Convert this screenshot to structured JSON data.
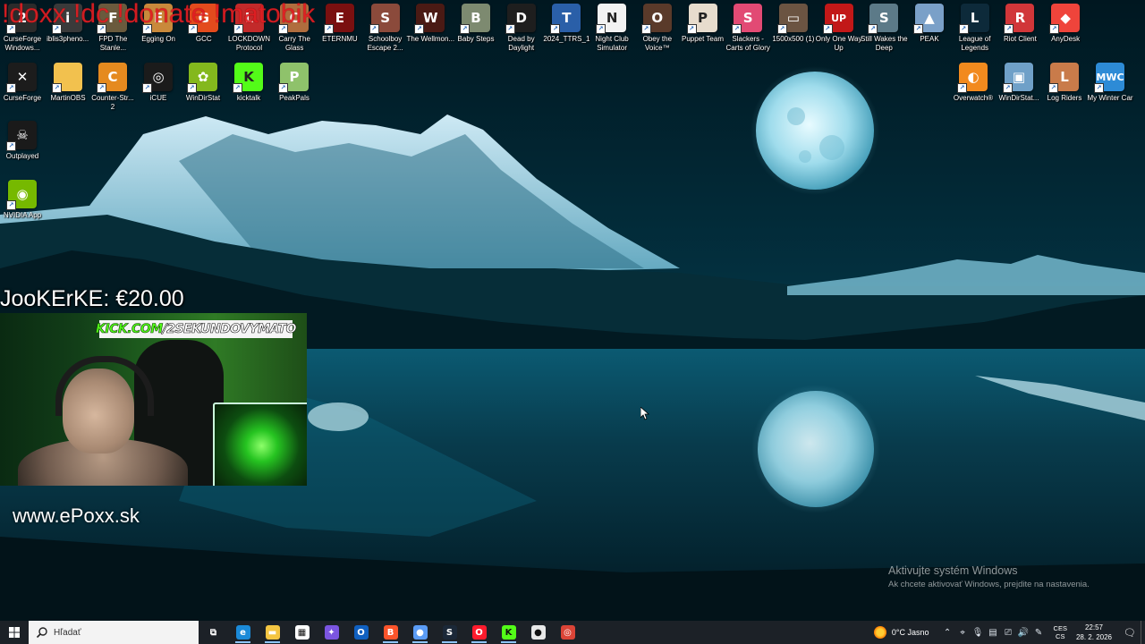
{
  "overlay": {
    "banner": "!doxx !dc !donate !matobik",
    "donation": "JooKErKE: €20.00",
    "kick_prefix": "KICK.COM",
    "kick_suffix": "/2SEKUNDOVYMATO",
    "website": "www.ePoxx.sk"
  },
  "desktop_icons": [
    {
      "label": "CurseForge Windows...",
      "icon": "curseforge-icon",
      "color": "#2b2b2b",
      "glyph": "2"
    },
    {
      "label": "iblis3pheno...",
      "icon": "iblis-icon",
      "color": "#3a3a3a",
      "glyph": "i"
    },
    {
      "label": "FPD The Stanle...",
      "icon": "stanley-icon",
      "color": "#6a5a3d",
      "glyph": "F"
    },
    {
      "label": "Egging On",
      "icon": "egging-on-icon",
      "color": "#c9893b",
      "glyph": "E"
    },
    {
      "label": "GCC",
      "icon": "gcc-icon",
      "color": "#e34b1d",
      "glyph": "G"
    },
    {
      "label": "LOCKDOWN Protocol",
      "icon": "lockdown-icon",
      "color": "#c22a2a",
      "glyph": "L"
    },
    {
      "label": "Carry The Glass",
      "icon": "carry-glass-icon",
      "color": "#b06d3e",
      "glyph": "C"
    },
    {
      "label": "ETERNMU",
      "icon": "eternmu-icon",
      "color": "#7a1010",
      "glyph": "E"
    },
    {
      "label": "Schoolboy Escape 2...",
      "icon": "schoolboy-icon",
      "color": "#8b4a3b",
      "glyph": "S"
    },
    {
      "label": "The Wellmon...",
      "icon": "wellmon-icon",
      "color": "#4a1a14",
      "glyph": "W"
    },
    {
      "label": "Baby Steps",
      "icon": "baby-steps-icon",
      "color": "#7d8a70",
      "glyph": "B"
    },
    {
      "label": "Dead by Daylight",
      "icon": "dbd-icon",
      "color": "#1e1e1e",
      "glyph": "D"
    },
    {
      "label": "2024_TTRS_1",
      "icon": "ttrs-icon",
      "color": "#2a5fa8",
      "glyph": "T"
    },
    {
      "label": "Night Club Simulator",
      "icon": "nightclub-icon",
      "color": "#f2f2f2",
      "glyph": "N"
    },
    {
      "label": "Obey the Voice™",
      "icon": "obey-voice-icon",
      "color": "#5a3a2a",
      "glyph": "O"
    },
    {
      "label": "Puppet Team",
      "icon": "puppet-team-icon",
      "color": "#e7dccd",
      "glyph": "P"
    },
    {
      "label": "Slackers - Carts of Glory",
      "icon": "slackers-icon",
      "color": "#e24a74",
      "glyph": "S"
    },
    {
      "label": "1500x500 (1)",
      "icon": "image-file-icon",
      "color": "#6b5442",
      "glyph": "▭"
    },
    {
      "label": "Only One Way Up",
      "icon": "only-one-way-up-icon",
      "color": "#c21818",
      "glyph": "UP"
    },
    {
      "label": "Still Wakes the Deep",
      "icon": "still-wakes-icon",
      "color": "#5c7a88",
      "glyph": "S"
    },
    {
      "label": "PEAK",
      "icon": "peak-icon",
      "color": "#7aa0c8",
      "glyph": "▲"
    },
    {
      "label": "League of Legends",
      "icon": "lol-icon",
      "color": "#0d2a3a",
      "glyph": "L"
    },
    {
      "label": "Riot Client",
      "icon": "riot-client-icon",
      "color": "#d13639",
      "glyph": "R"
    },
    {
      "label": "AnyDesk",
      "icon": "anydesk-icon",
      "color": "#ef443b",
      "glyph": "◆"
    },
    {
      "label": "CurseForge",
      "icon": "curseforge-app-icon",
      "color": "#1c1c1c",
      "glyph": "✕"
    },
    {
      "label": "MartinOBS",
      "icon": "folder-icon",
      "color": "#f2c14e",
      "glyph": ""
    },
    {
      "label": "Counter-Str... 2",
      "icon": "cs2-icon",
      "color": "#e58a1f",
      "glyph": "C"
    },
    {
      "label": "iCUE",
      "icon": "icue-icon",
      "color": "#1b1b1b",
      "glyph": "◎"
    },
    {
      "label": "WinDirStat",
      "icon": "windirstat-icon",
      "color": "#84b81d",
      "glyph": "✿"
    },
    {
      "label": "kicktalk",
      "icon": "kicktalk-icon",
      "color": "#53fc18",
      "glyph": "K"
    },
    {
      "label": "PeakPals",
      "icon": "peakpals-icon",
      "color": "#8fc26b",
      "glyph": "P"
    },
    {
      "label": "Overwatch®",
      "icon": "overwatch-icon",
      "color": "#f28a1e",
      "glyph": "◐"
    },
    {
      "label": "WinDirStat...",
      "icon": "windirstat-setup-icon",
      "color": "#6fa0c8",
      "glyph": "▣"
    },
    {
      "label": "Log Riders",
      "icon": "log-riders-icon",
      "color": "#c97b4a",
      "glyph": "L"
    },
    {
      "label": "My Winter Car",
      "icon": "my-winter-car-icon",
      "color": "#2d8bd6",
      "glyph": "MWC"
    },
    {
      "label": "Outplayed",
      "icon": "outplayed-icon",
      "color": "#1a1a1a",
      "glyph": "☠"
    },
    {
      "label": "NVIDIA App",
      "icon": "nvidia-icon",
      "color": "#76b900",
      "glyph": "◉"
    }
  ],
  "watermark": {
    "line1": "Aktivujte systém Windows",
    "line2": "Ak chcete aktivovať Windows, prejdite na nastavenia."
  },
  "taskbar": {
    "search_placeholder": "Hľadať",
    "apps": [
      {
        "icon": "task-view-icon",
        "color": "transparent",
        "glyph": "⧉"
      },
      {
        "icon": "edge-icon",
        "color": "#1b8ad8",
        "glyph": "e"
      },
      {
        "icon": "file-explorer-icon",
        "color": "#f4c542",
        "glyph": "▬"
      },
      {
        "icon": "store-icon",
        "color": "#ffffff",
        "glyph": "▦"
      },
      {
        "icon": "copilot-icon",
        "color": "#7b55e0",
        "glyph": "✦"
      },
      {
        "icon": "outlook-icon",
        "color": "#1060c0",
        "glyph": "O"
      },
      {
        "icon": "brave-icon",
        "color": "#fb542b",
        "glyph": "B"
      },
      {
        "icon": "browser-icon",
        "color": "#5b9cf5",
        "glyph": "●"
      },
      {
        "icon": "steam-icon",
        "color": "#1b2838",
        "glyph": "S"
      },
      {
        "icon": "opera-icon",
        "color": "#ff1b2d",
        "glyph": "O"
      },
      {
        "icon": "kick-icon",
        "color": "#53fc18",
        "glyph": "K"
      },
      {
        "icon": "obs-icon",
        "color": "#e8e8e8",
        "glyph": "●"
      },
      {
        "icon": "chrome-icon",
        "color": "#db4437",
        "glyph": "◎"
      }
    ],
    "weather": "0°C  Jasno",
    "lang_top": "CES",
    "lang_bottom": "CS",
    "time": "22:57",
    "date": "28. 2. 2026"
  }
}
